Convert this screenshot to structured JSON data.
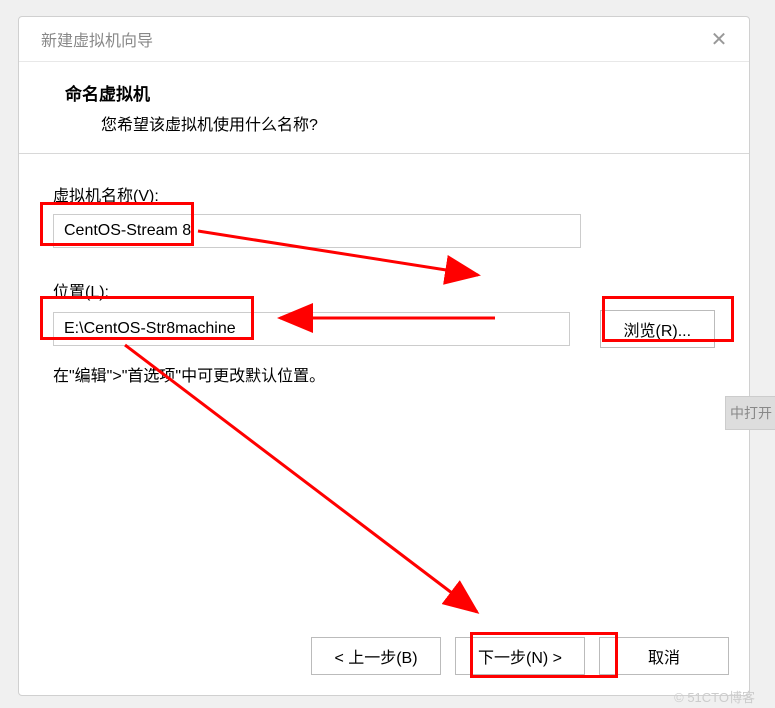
{
  "titlebar": {
    "title": "新建虚拟机向导"
  },
  "header": {
    "title": "命名虚拟机",
    "subtitle": "您希望该虚拟机使用什么名称?"
  },
  "fields": {
    "name_label": "虚拟机名称(V):",
    "name_value": "CentOS-Stream 8",
    "location_label": "位置(L):",
    "location_value": "E:\\CentOS-Str8machine",
    "browse_label": "浏览(R)...",
    "hint": "在\"编辑\">\"首选项\"中可更改默认位置。"
  },
  "footer": {
    "back": "< 上一步(B)",
    "next": "下一步(N) >",
    "cancel": "取消"
  },
  "side_label": "中打开",
  "watermark": "© 51CTO博客"
}
